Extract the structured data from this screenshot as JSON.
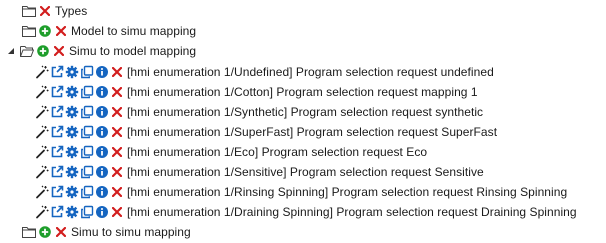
{
  "colors": {
    "add": "#1e9e2b",
    "remove": "#d21d1d",
    "action": "#1565c0",
    "folder": "#444444",
    "text": "#1a1a1a"
  },
  "icons": {
    "folder": "folder-icon",
    "expand": "expand-arrow-icon",
    "collapse": "collapse-arrow-icon",
    "add": "add-icon",
    "remove": "remove-icon",
    "wand": "magic-wand-icon",
    "edit": "edit-external-icon",
    "settings": "gear-icon",
    "copy": "copy-icon",
    "info": "info-icon"
  },
  "tree": {
    "types": {
      "label": "Types"
    },
    "model_to_simu": {
      "label": "Model to simu mapping"
    },
    "simu_to_model": {
      "label": "Simu to model mapping",
      "items": [
        {
          "label": "[hmi enumeration 1/Undefined] Program selection request undefined"
        },
        {
          "label": "[hmi enumeration 1/Cotton] Program selection request mapping 1"
        },
        {
          "label": "[hmi enumeration 1/Synthetic] Program selection request synthetic"
        },
        {
          "label": "[hmi enumeration 1/SuperFast] Program selection request SuperFast"
        },
        {
          "label": "[hmi enumeration 1/Eco] Program selection request Eco"
        },
        {
          "label": "[hmi enumeration 1/Sensitive] Program selection request Sensitive"
        },
        {
          "label": "[hmi enumeration 1/Rinsing Spinning] Program selection request Rinsing Spinning"
        },
        {
          "label": "[hmi enumeration 1/Draining Spinning] Program selection request Draining Spinning"
        }
      ]
    },
    "simu_to_simu": {
      "label": "Simu to simu mapping"
    }
  }
}
